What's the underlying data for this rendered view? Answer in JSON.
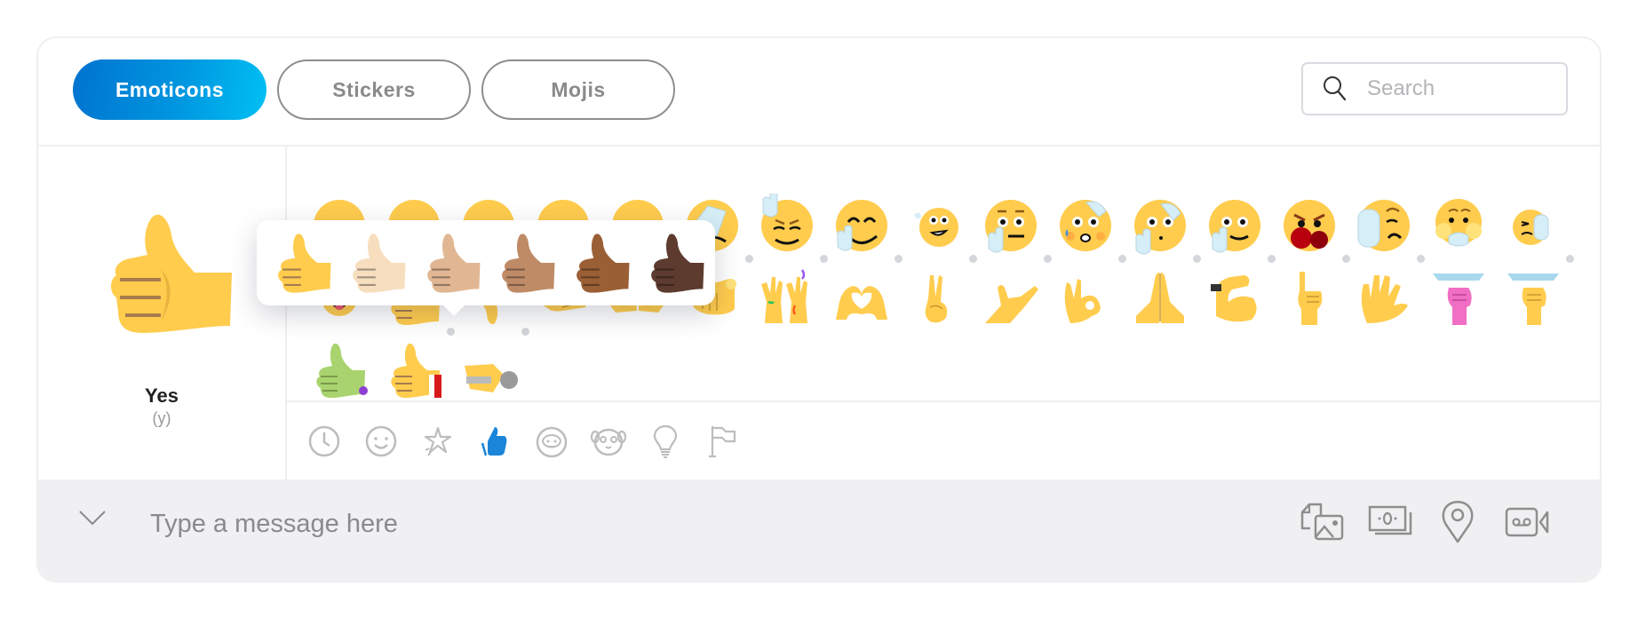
{
  "tabs": [
    {
      "label": "Emoticons",
      "active": true
    },
    {
      "label": "Stickers",
      "active": false
    },
    {
      "label": "Mojis",
      "active": false
    }
  ],
  "search": {
    "placeholder": "Search",
    "value": "",
    "icon": "search-icon"
  },
  "preview": {
    "name": "Yes",
    "shortcut": "(y)",
    "icon": "thumbs-up-icon"
  },
  "skin_tone_popup": {
    "tones": [
      {
        "name": "default",
        "color": "#FFCC4D"
      },
      {
        "name": "light",
        "color": "#F7DEBF"
      },
      {
        "name": "medium-light",
        "color": "#E1B793"
      },
      {
        "name": "medium",
        "color": "#BF8B67"
      },
      {
        "name": "medium-dark",
        "color": "#9B5F36"
      },
      {
        "name": "dark",
        "color": "#5D3B2E"
      }
    ]
  },
  "emoji_grid": {
    "rows": [
      [
        "facepalm-face",
        "rock-on-face",
        "fingers-crossed-face",
        "waving-face",
        "thinking-finger-face",
        "worried-face",
        "hiding-face",
        "call-me-face",
        "boxing-face",
        "stop-face",
        "shocked-cover-face",
        "wince-face"
      ],
      [
        "laughing-tears",
        "thumbs-up",
        "thumbs-down",
        "handshake",
        "fist-bump",
        "pointing",
        "hands-celebrate",
        "heart-hands",
        "victory",
        "hang-loose",
        "ok-hand",
        "praying-hands",
        "flexed-biceps",
        "rock-hand",
        "vulcan-salute",
        "raised-fist-pink",
        "raised-fist"
      ],
      [
        "zombie-thumbs-up",
        "santa-thumbs-up",
        "microphone-hand"
      ]
    ],
    "row1_hidden_count": 5
  },
  "categories": [
    {
      "name": "recent",
      "icon": "clock-icon",
      "active": false
    },
    {
      "name": "smileys",
      "icon": "smiley-icon",
      "active": false
    },
    {
      "name": "sparkle",
      "icon": "star-icon",
      "active": false
    },
    {
      "name": "hands",
      "icon": "thumbs-up-icon",
      "active": true
    },
    {
      "name": "people",
      "icon": "person-face-icon",
      "active": false
    },
    {
      "name": "animals",
      "icon": "panda-icon",
      "active": false
    },
    {
      "name": "objects",
      "icon": "lightbulb-icon",
      "active": false
    },
    {
      "name": "flags",
      "icon": "flag-icon",
      "active": false
    }
  ],
  "composer": {
    "placeholder": "Type a message here",
    "value": "",
    "actions": [
      {
        "name": "send-file",
        "icon": "file-image-icon"
      },
      {
        "name": "send-money",
        "icon": "money-icon"
      },
      {
        "name": "send-location",
        "icon": "location-pin-icon"
      },
      {
        "name": "video-message",
        "icon": "video-message-icon"
      }
    ]
  },
  "colors": {
    "accent": "#0078D4",
    "accent_light": "#00C0F3",
    "active_category": "#1A85D9",
    "emoji_yellow": "#FFCC4D",
    "icon_gray": "#8E8E8E"
  }
}
